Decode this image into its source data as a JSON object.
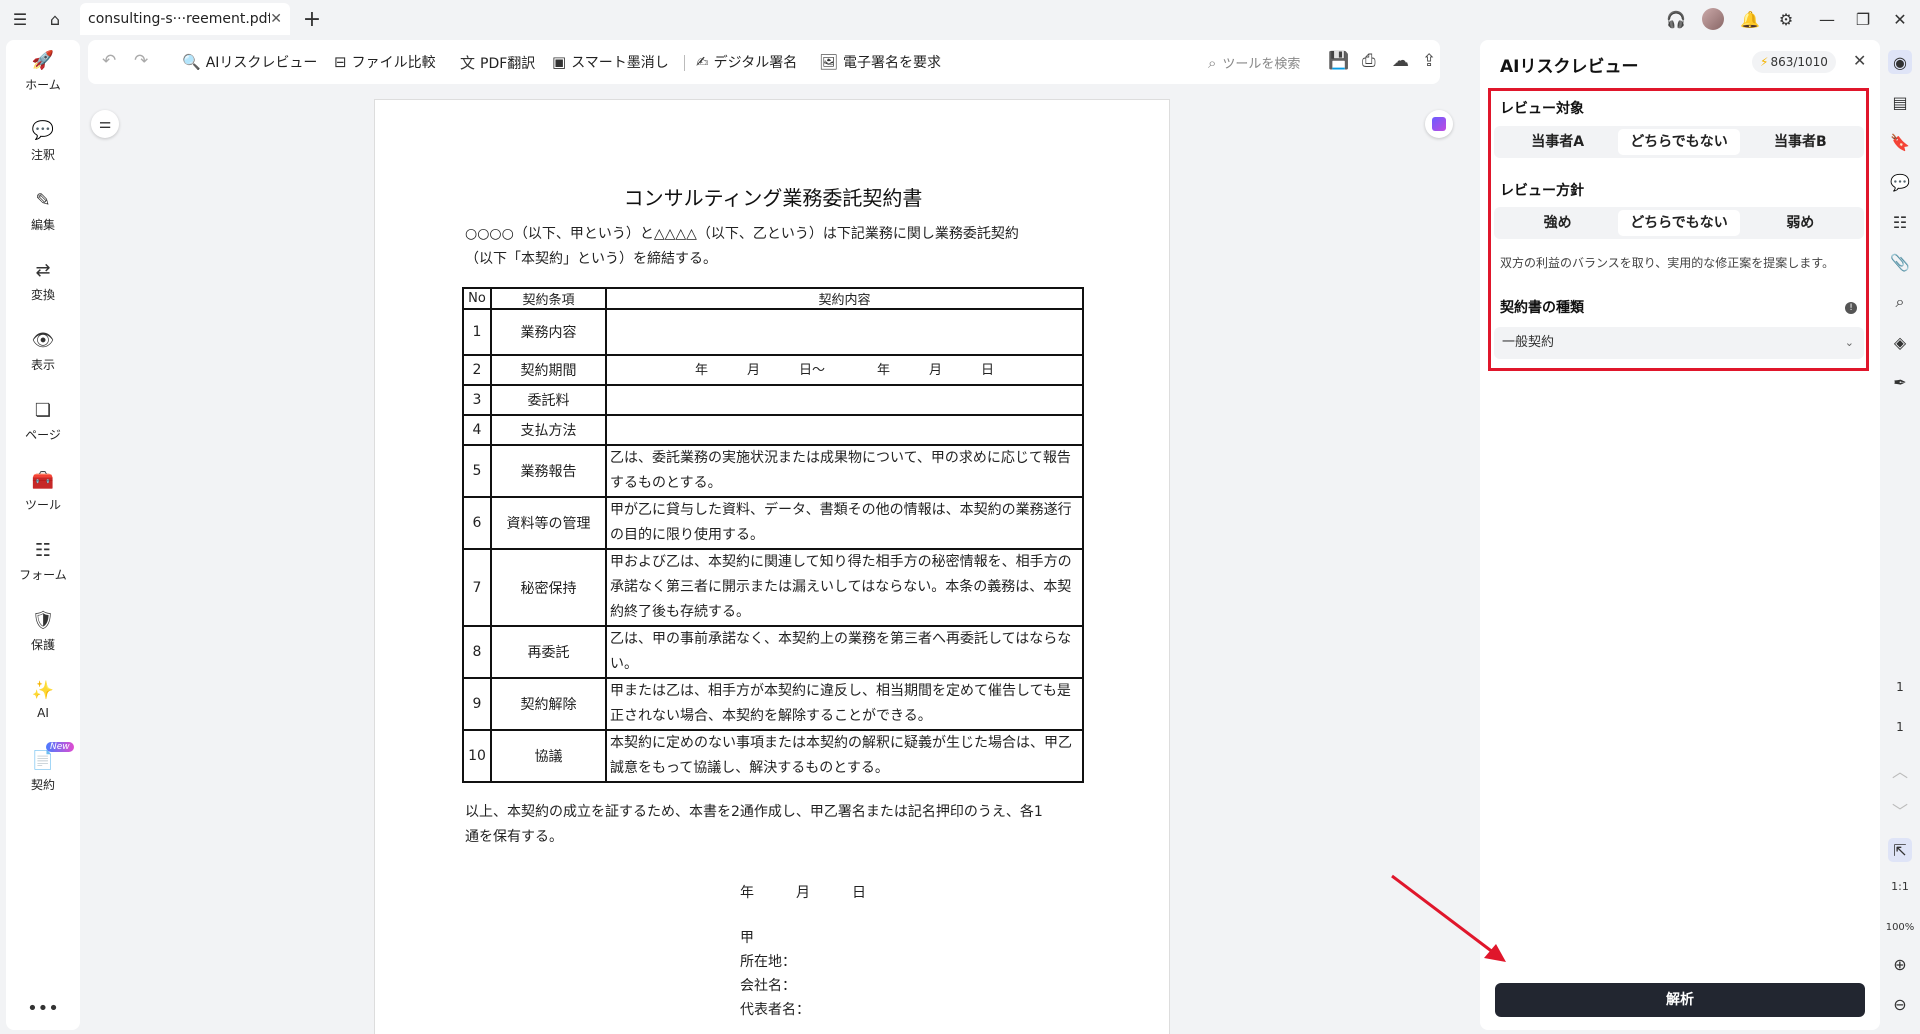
{
  "tab": {
    "title": "consulting-s···reement.pdf"
  },
  "sidebar": {
    "items": [
      {
        "label": "ホーム",
        "icon": "rocket-icon"
      },
      {
        "label": "注釈",
        "icon": "comment-icon"
      },
      {
        "label": "編集",
        "icon": "edit-icon"
      },
      {
        "label": "変換",
        "icon": "convert-icon"
      },
      {
        "label": "表示",
        "icon": "eye-icon"
      },
      {
        "label": "ページ",
        "icon": "pages-icon"
      },
      {
        "label": "ツール",
        "icon": "toolbox-icon"
      },
      {
        "label": "フォーム",
        "icon": "form-icon"
      },
      {
        "label": "保護",
        "icon": "shield-icon"
      },
      {
        "label": "AI",
        "icon": "magic-wand-icon"
      },
      {
        "label": "契約",
        "icon": "contract-icon"
      }
    ],
    "new_badge": "New"
  },
  "toolbar": {
    "ai_review": "AIリスクレビュー",
    "compare": "ファイル比較",
    "translate": "PDF翻訳",
    "redact": "スマート墨消し",
    "digital_sign": "デジタル署名",
    "request_sign": "電子署名を要求",
    "search_placeholder": "ツールを検索"
  },
  "document": {
    "title": "コンサルティング業務委託契約書",
    "intro_line1": "○○○○（以下、甲という）と△△△△（以下、乙という）は下記業務に関し業務委託契約",
    "intro_line2": "（以下「本契約」という）を締結する。",
    "headers": {
      "no": "No",
      "item": "契約条項",
      "content": "契約内容"
    },
    "rows": [
      {
        "no": "1",
        "item": "業務内容",
        "content": ""
      },
      {
        "no": "2",
        "item": "契約期間",
        "content": "年　　　月　　　日～　　　　年　　　月　　　日"
      },
      {
        "no": "3",
        "item": "委託料",
        "content": ""
      },
      {
        "no": "4",
        "item": "支払方法",
        "content": ""
      },
      {
        "no": "5",
        "item": "業務報告",
        "content": "乙は、委託業務の実施状況または成果物について、甲の求めに応じて報告するものとする。"
      },
      {
        "no": "6",
        "item": "資料等の管理",
        "content": "甲が乙に貸与した資料、データ、書類その他の情報は、本契約の業務遂行の目的に限り使用する。"
      },
      {
        "no": "7",
        "item": "秘密保持",
        "content": "甲および乙は、本契約に関連して知り得た相手方の秘密情報を、相手方の承諾なく第三者に開示または漏えいしてはならない。本条の義務は、本契約終了後も存続する。"
      },
      {
        "no": "8",
        "item": "再委託",
        "content": "乙は、甲の事前承諾なく、本契約上の業務を第三者へ再委託してはならない。"
      },
      {
        "no": "9",
        "item": "契約解除",
        "content": "甲または乙は、相手方が本契約に違反し、相当期間を定めて催告しても是正されない場合、本契約を解除することができる。"
      },
      {
        "no": "10",
        "item": "協議",
        "content": "本契約に定めのない事項または本契約の解釈に疑義が生じた場合は、甲乙誠意をもって協議し、解決するものとする。"
      }
    ],
    "closing_line1": "以上、本契約の成立を証するため、本書を2通作成し、甲乙署名または記名押印のうえ、各1",
    "closing_line2": "通を保有する。",
    "date_line": "年　　　月　　　日",
    "party": "甲",
    "address": "所在地：",
    "company": "会社名：",
    "representative": "代表者名："
  },
  "panel": {
    "title": "AIリスクレビュー",
    "credits": "863/1010",
    "target_label": "レビュー対象",
    "target_options": [
      "当事者A",
      "どちらでもない",
      "当事者B"
    ],
    "target_selected": 1,
    "policy_label": "レビュー方針",
    "policy_options": [
      "強め",
      "どちらでもない",
      "弱め"
    ],
    "policy_selected": 1,
    "policy_desc": "双方の利益のバランスを取り、実用的な修正案を提案します。",
    "type_label": "契約書の種類",
    "type_value": "一般契約",
    "analyze_label": "解析"
  },
  "rail": {
    "page_current": "1",
    "page_total": "1",
    "fit_label": "1:1",
    "zoom": "100%"
  },
  "colors": {
    "highlight_box": "#e0162b",
    "analyze_button": "#222630",
    "arrow": "#e0162b"
  }
}
